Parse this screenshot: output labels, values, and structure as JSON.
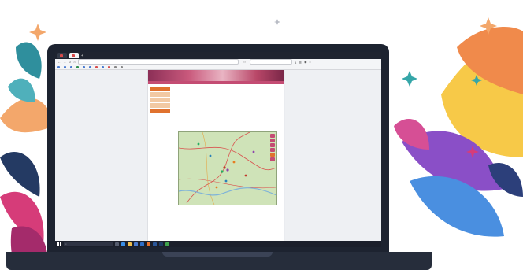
{
  "browser": {
    "tabs": [
      {
        "title": "",
        "favicon_color": "#d94b4b",
        "active": false
      },
      {
        "title": "",
        "favicon_color": "#d94b4b",
        "active": true
      }
    ],
    "new_tab_symbol": "+",
    "url": "",
    "search_placeholder": "",
    "zoom": "",
    "bookmarks": [
      {
        "label": "",
        "color": "#4a7bd0"
      },
      {
        "label": "",
        "color": "#4a7bd0"
      },
      {
        "label": "",
        "color": "#4a7bd0"
      },
      {
        "label": "",
        "color": "#2d8f4e"
      },
      {
        "label": "",
        "color": "#4a7bd0"
      },
      {
        "label": "",
        "color": "#4a7bd0"
      },
      {
        "label": "",
        "color": "#d94b4b"
      },
      {
        "label": "",
        "color": "#4a7bd0"
      },
      {
        "label": "",
        "color": "#d94b4b"
      },
      {
        "label": "",
        "color": "#888888"
      },
      {
        "label": "",
        "color": "#888888"
      }
    ]
  },
  "website": {
    "nav_items": [
      "",
      "",
      "",
      "",
      "",
      "",
      "",
      "",
      "",
      "",
      ""
    ],
    "side_menu": [
      "",
      "",
      "",
      "",
      ""
    ],
    "title_lines": [
      "",
      "",
      "",
      ""
    ],
    "paragraph1": "",
    "paragraph2": "",
    "link_text": "",
    "map_credit": "",
    "footer_lines": [
      "",
      ""
    ]
  },
  "taskbar": {
    "search_placeholder": "",
    "time": "",
    "date": ""
  },
  "colors": {
    "accent": "#c44c73",
    "menu_orange": "#e0722f",
    "title_red": "#c0392b"
  }
}
